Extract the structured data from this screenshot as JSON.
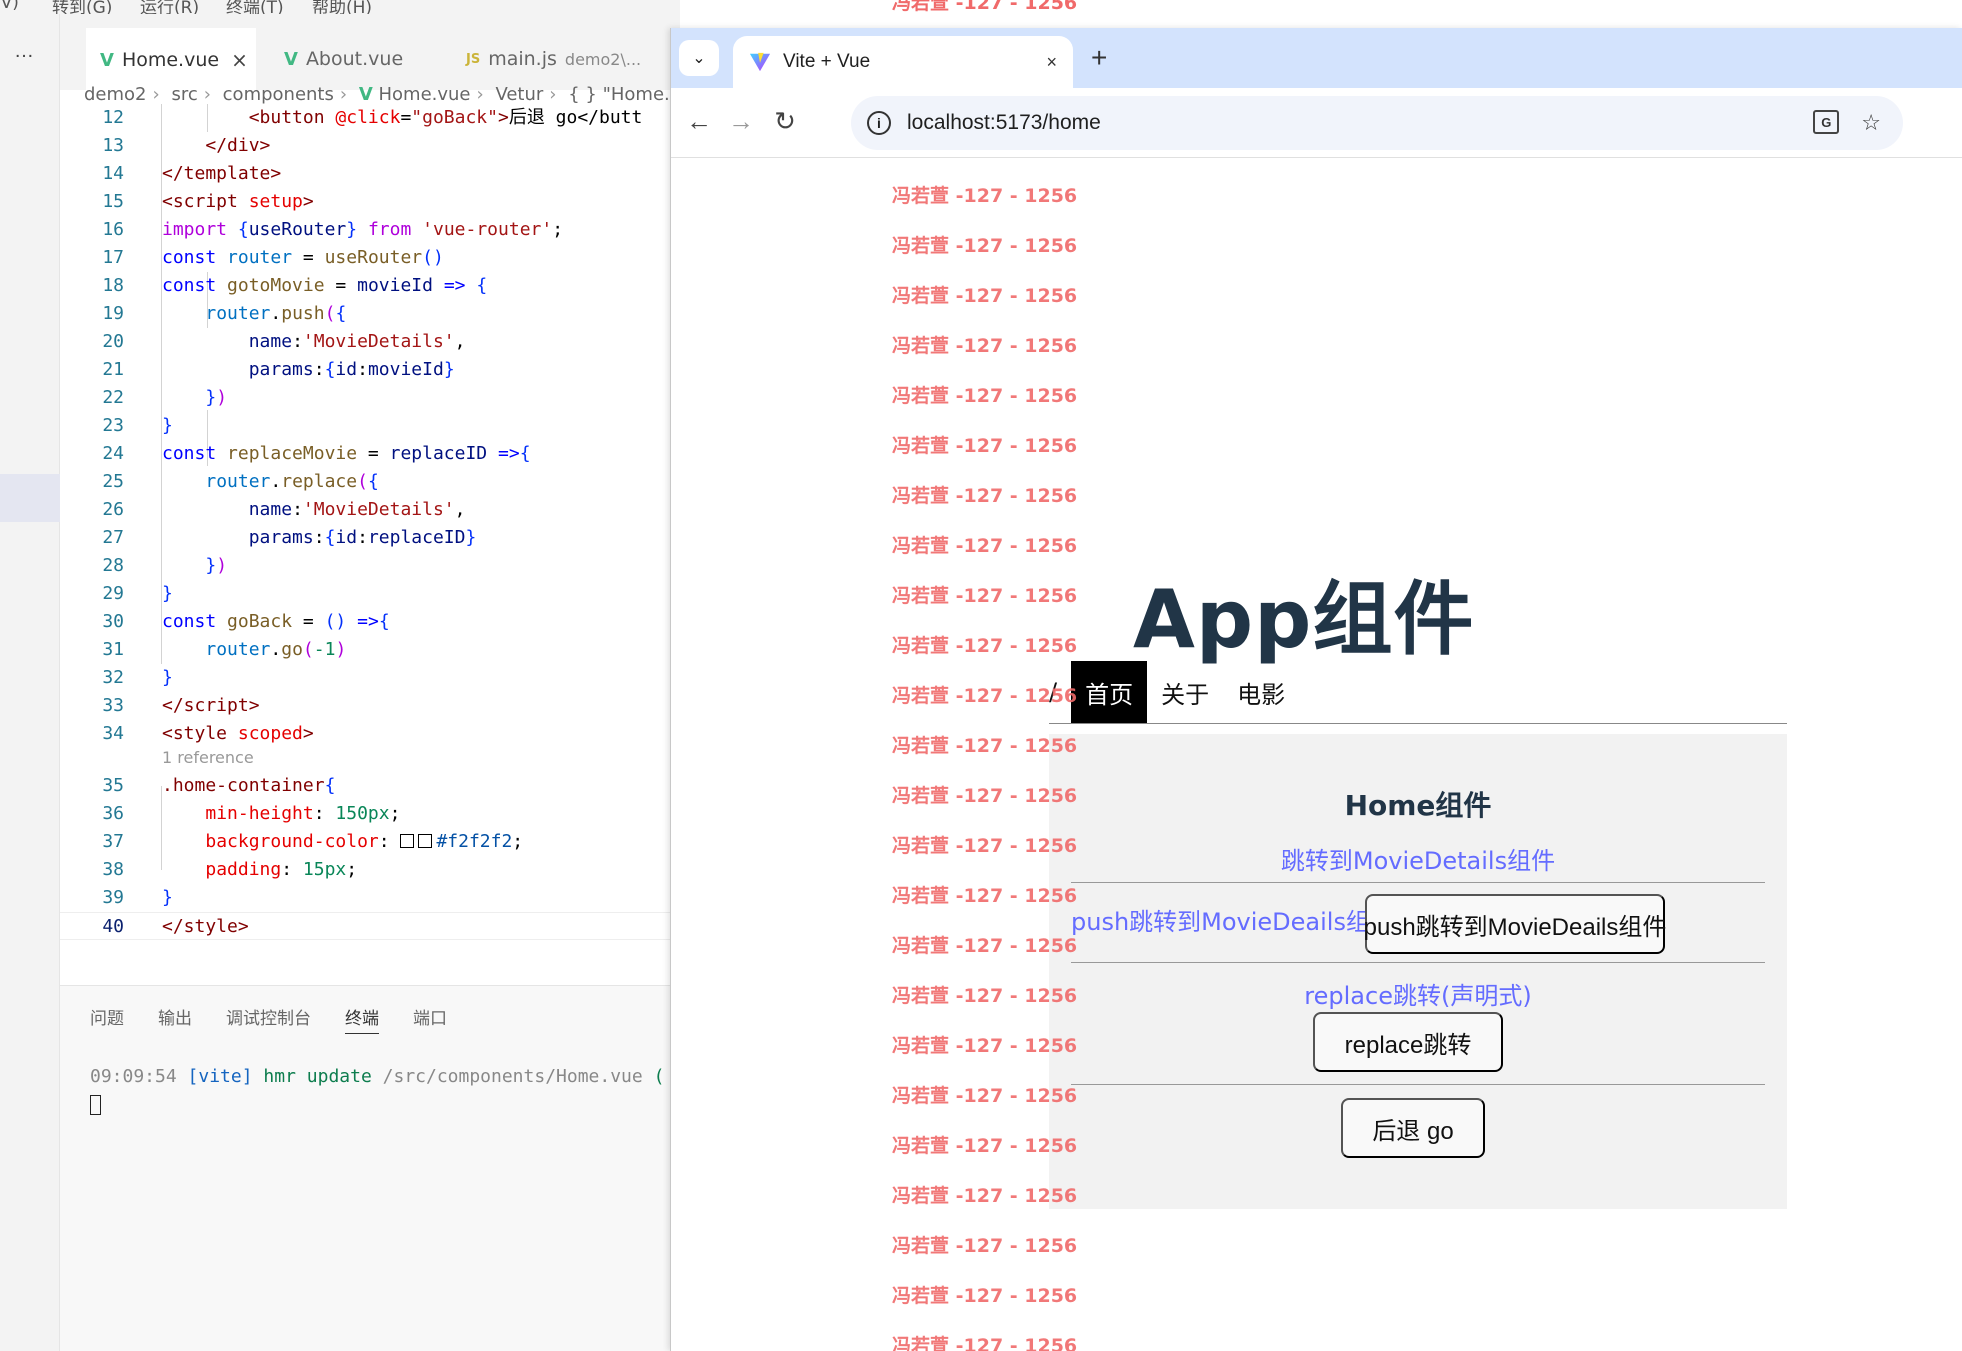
{
  "vscode": {
    "menubar": [
      "(V)",
      "转到(G)",
      "运行(R)",
      "终端(T)",
      "帮助(H)"
    ],
    "more_icon": "…",
    "tabs": [
      {
        "label": "Home.vue",
        "icon": "vue-icon",
        "active": true,
        "close": "×"
      },
      {
        "label": "About.vue",
        "icon": "vue-icon",
        "active": false
      },
      {
        "label": "main.js",
        "hint": "demo2\\...",
        "icon": "js-icon",
        "active": false
      }
    ],
    "breadcrumb": [
      "demo2",
      "src",
      "components",
      "Home.vue",
      "Vetur",
      "{ } \"Home.vue\""
    ],
    "code_ref": "1 reference",
    "panel_tabs": [
      "问题",
      "输出",
      "调试控制台",
      "终端",
      "端口"
    ],
    "panel_active": "终端",
    "terminal": {
      "time": "09:09:54",
      "tag": "[vite]",
      "msg": "hmr update",
      "path": "/src/components/Home.vue",
      "tail": "("
    }
  },
  "browser": {
    "tab_title": "Vite + Vue",
    "tab_close": "×",
    "new_tab": "+",
    "url": "localhost:5173/home",
    "colors": {
      "tabstrip": "#d3e3fd",
      "vue_link": "#646cff",
      "title": "#213547",
      "container_bg": "#f2f2f2",
      "watermark": "#f06a6a"
    }
  },
  "app": {
    "title": "App组件",
    "nav_sep": "/",
    "nav": [
      {
        "label": "首页",
        "active": true
      },
      {
        "label": "关于",
        "active": false
      },
      {
        "label": "电影",
        "active": false
      }
    ],
    "home_title": "Home组件",
    "link_movie": "跳转到MovieDetails组件",
    "link_push": "push跳转到MovieDeails组件",
    "btn_push": "push跳转到MovieDeails组件",
    "link_replace": "replace跳转(声明式)",
    "btn_replace": "replace跳转",
    "btn_back": "后退 go"
  },
  "watermark_text": "冯若萱 -127 - 1256",
  "watermark_count": 26
}
